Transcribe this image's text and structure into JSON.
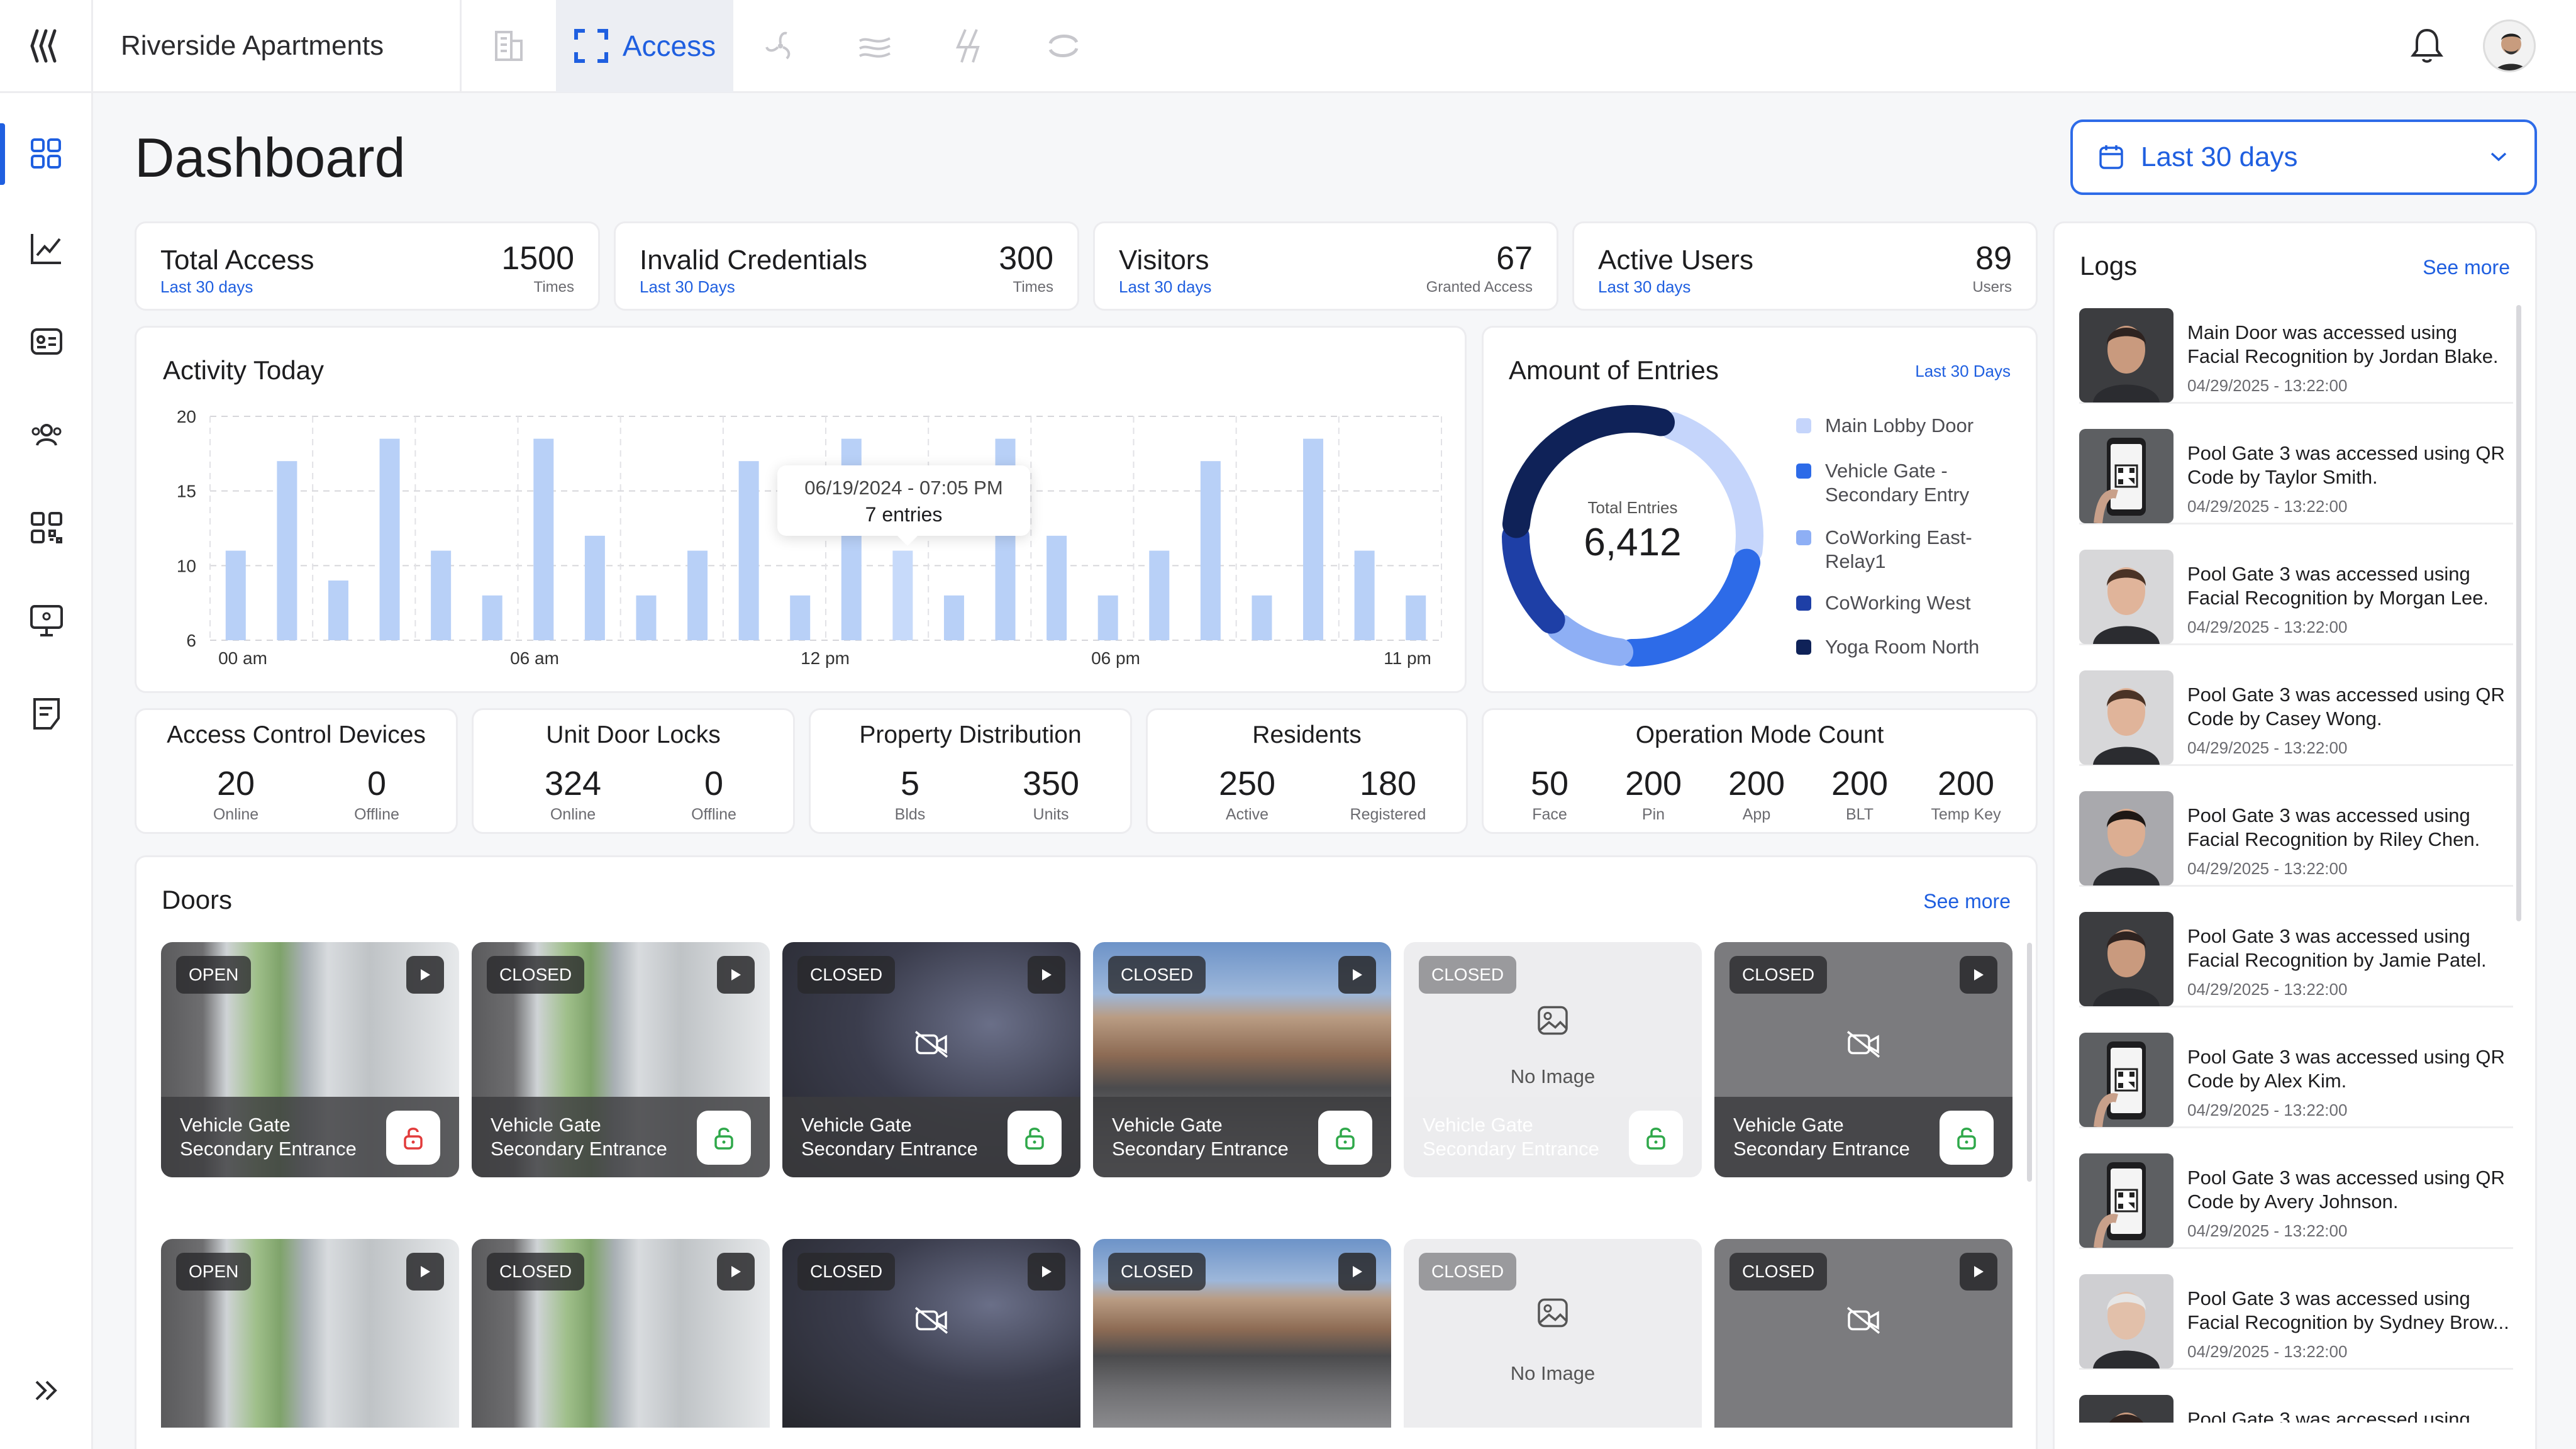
{
  "app": {
    "property_name": "Riverside Apartments",
    "active_tab": "Access"
  },
  "page": {
    "title": "Dashboard",
    "date_range": "Last 30 days"
  },
  "stats": [
    {
      "title": "Total Access",
      "sub": "Last 30 days",
      "value": "1500",
      "unit": "Times"
    },
    {
      "title": "Invalid Credentials",
      "sub": "Last 30 Days",
      "value": "300",
      "unit": "Times"
    },
    {
      "title": "Visitors",
      "sub": "Last 30 days",
      "value": "67",
      "unit": "Granted Access"
    },
    {
      "title": "Active Users",
      "sub": "Last 30 days",
      "value": "89",
      "unit": "Users"
    }
  ],
  "activity": {
    "title": "Activity Today",
    "tooltip_time": "06/19/2024 - 07:05 PM",
    "tooltip_value": "7 entries"
  },
  "chart_data": [
    {
      "type": "bar",
      "title": "Activity Today",
      "x_tick_labels": [
        "00 am",
        "06 am",
        "12 pm",
        "06 pm",
        "11 pm"
      ],
      "y_tick_labels": [
        "20",
        "15",
        "10",
        "6"
      ],
      "ylim": [
        5,
        20
      ],
      "grid": true,
      "values": [
        11,
        17,
        9,
        18.5,
        11,
        8,
        18.5,
        12,
        8,
        11,
        17,
        8,
        18.5,
        11,
        8,
        18.5,
        12,
        8,
        11,
        17,
        8,
        18.5,
        11,
        8
      ]
    },
    {
      "type": "pie",
      "title": "Amount of Entries",
      "subtitle": "Last 30 Days",
      "center_label": "Total Entries",
      "center_value": "6,412",
      "categories": [
        "Main Lobby Door",
        "Vehicle Gate - Secondary Entry",
        "CoWorking East-Relay1",
        "CoWorking West",
        "Yoga Room North"
      ],
      "values": [
        22,
        22,
        9,
        13,
        28
      ],
      "colors": [
        "#c5d5fb",
        "#2d6be8",
        "#8eaff5",
        "#1e3fa6",
        "#0f2258"
      ]
    }
  ],
  "entries": {
    "title": "Amount of Entries",
    "sub": "Last 30 Days",
    "center_label": "Total Entries",
    "center_value": "6,412"
  },
  "legend": [
    {
      "label1": "Main Lobby Door",
      "label2": ""
    },
    {
      "label1": "Vehicle Gate -",
      "label2": "Secondary Entry"
    },
    {
      "label1": "CoWorking East-",
      "label2": "Relay1"
    },
    {
      "label1": "CoWorking West",
      "label2": ""
    },
    {
      "label1": "Yoga Room North",
      "label2": ""
    }
  ],
  "counts": [
    {
      "title": "Access Control Devices",
      "cells": [
        {
          "value": "20",
          "label": "Online"
        },
        {
          "value": "0",
          "label": "Offline"
        }
      ]
    },
    {
      "title": "Unit Door Locks",
      "cells": [
        {
          "value": "324",
          "label": "Online"
        },
        {
          "value": "0",
          "label": "Offline"
        }
      ]
    },
    {
      "title": "Property Distribution",
      "cells": [
        {
          "value": "5",
          "label": "Blds"
        },
        {
          "value": "350",
          "label": "Units"
        }
      ]
    },
    {
      "title": "Residents",
      "cells": [
        {
          "value": "250",
          "label": "Active"
        },
        {
          "value": "180",
          "label": "Registered"
        }
      ]
    },
    {
      "title": "Operation Mode Count",
      "cells": [
        {
          "value": "50",
          "label": "Face"
        },
        {
          "value": "200",
          "label": "Pin"
        },
        {
          "value": "200",
          "label": "App"
        },
        {
          "value": "200",
          "label": "BLT"
        },
        {
          "value": "200",
          "label": "Temp Key"
        }
      ]
    }
  ],
  "doors": {
    "title": "Doors",
    "see_more": "See more",
    "no_image": "No Image",
    "items": [
      {
        "status": "OPEN",
        "name1": "Vehicle Gate",
        "name2": "Secondary Entrance",
        "lock": "red"
      },
      {
        "status": "CLOSED",
        "name1": "Vehicle Gate",
        "name2": "Secondary Entrance",
        "lock": "green"
      },
      {
        "status": "CLOSED",
        "name1": "Vehicle Gate",
        "name2": "Secondary Entrance",
        "lock": "green"
      },
      {
        "status": "CLOSED",
        "name1": "Vehicle Gate",
        "name2": "Secondary Entrance",
        "lock": "green"
      },
      {
        "status": "CLOSED",
        "name1": "Vehicle Gate",
        "name2": "Secondary Entrance",
        "lock": "green"
      },
      {
        "status": "CLOSED",
        "name1": "Vehicle Gate",
        "name2": "Secondary Entrance",
        "lock": "green"
      },
      {
        "status": "OPEN"
      },
      {
        "status": "CLOSED"
      },
      {
        "status": "CLOSED"
      },
      {
        "status": "CLOSED"
      },
      {
        "status": "CLOSED"
      },
      {
        "status": "CLOSED"
      }
    ]
  },
  "logs": {
    "title": "Logs",
    "see_more": "See more",
    "items": [
      {
        "line1": "Main Door was accessed using",
        "line2": "Facial Recognition by Jordan Blake.",
        "time": "04/29/2025 - 13:22:00",
        "kind": "face-m"
      },
      {
        "line1": "Pool Gate 3 was accessed using QR",
        "line2": "Code by Taylor Smith.",
        "time": "04/29/2025 - 13:22:00",
        "kind": "qr"
      },
      {
        "line1": "Pool Gate 3 was accessed using",
        "line2": "Facial Recognition by Morgan Lee.",
        "time": "04/29/2025 - 13:22:00",
        "kind": "face-f"
      },
      {
        "line1": "Pool Gate 3 was accessed using QR",
        "line2": "Code by Casey Wong.",
        "time": "04/29/2025 - 13:22:00",
        "kind": "face-f"
      },
      {
        "line1": "Pool Gate 3 was accessed using",
        "line2": "Facial Recognition by Riley Chen.",
        "time": "04/29/2025 - 13:22:00",
        "kind": "face-f2"
      },
      {
        "line1": "Pool Gate 3 was accessed using",
        "line2": "Facial Recognition by Jamie Patel.",
        "time": "04/29/2025 - 13:22:00",
        "kind": "face-m"
      },
      {
        "line1": "Pool Gate 3 was accessed using QR",
        "line2": "Code by Alex Kim.",
        "time": "04/29/2025 - 13:22:00",
        "kind": "qr"
      },
      {
        "line1": "Pool Gate 3 was accessed using QR",
        "line2": "Code by Avery Johnson.",
        "time": "04/29/2025 - 13:22:00",
        "kind": "qr"
      },
      {
        "line1": "Pool Gate 3 was accessed using",
        "line2": "Facial Recognition by Sydney Brow...",
        "time": "04/29/2025 - 13:22:00",
        "kind": "face-old"
      },
      {
        "line1": "Pool Gate 3 was accessed using",
        "line2": "",
        "time": "",
        "kind": "face-m"
      }
    ]
  },
  "colors": {
    "accent": "#1f5fe0",
    "bar": "#b8d0f7",
    "bar_highlight": "#c7dafa",
    "lock_red": "#e23b3b",
    "lock_green": "#2fa84a"
  }
}
